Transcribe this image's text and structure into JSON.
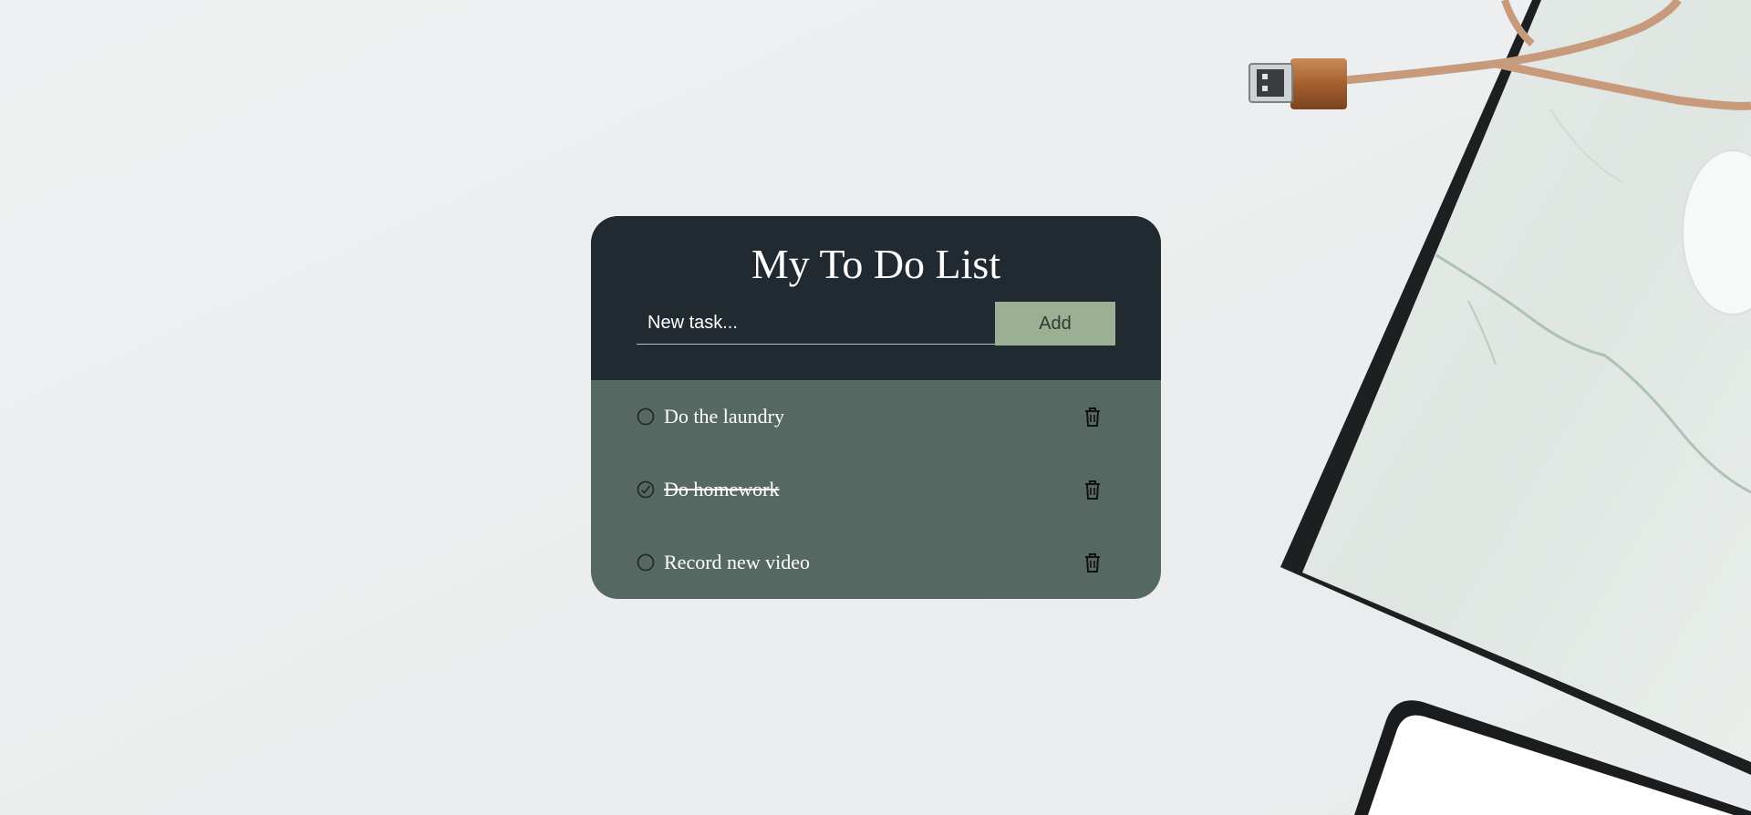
{
  "app": {
    "title": "My To Do List"
  },
  "new_task": {
    "placeholder": "New task...",
    "value": "",
    "add_label": "Add"
  },
  "tasks": [
    {
      "text": "Do the laundry",
      "done": false
    },
    {
      "text": "Do homework",
      "done": true
    },
    {
      "text": "Record new video",
      "done": false
    }
  ],
  "colors": {
    "header": "#212a30",
    "list_background": "#556962",
    "accent_button": "#9bb092",
    "page_background": "#eceeef"
  },
  "icons": {
    "unchecked": "circle-icon",
    "checked": "check-circle-icon",
    "delete": "trash-icon"
  }
}
